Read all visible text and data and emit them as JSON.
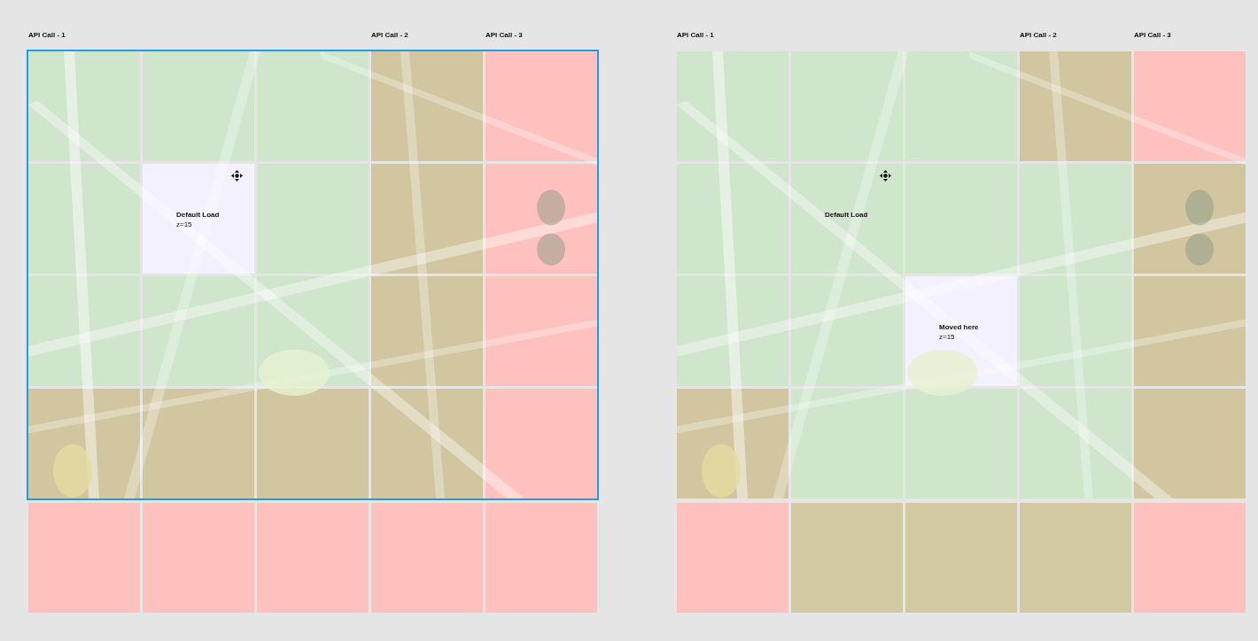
{
  "panels": [
    {
      "selected": true,
      "columns": [
        {
          "header": "API Call - 1"
        },
        {},
        {},
        {
          "header": "API Call - 2"
        },
        {
          "header": "API Call - 3"
        }
      ],
      "rows": [
        {
          "tiles": [
            {
              "color": "#cfe5cc"
            },
            {
              "color": "#cfe5cc"
            },
            {
              "color": "#cfe5cc"
            },
            {
              "color": "#d1c6a0"
            },
            {
              "color": "#ffc1bd"
            }
          ]
        },
        {
          "tiles": [
            {
              "color": "#cfe5cc"
            },
            {
              "color": "#f2f1fd",
              "title": "Default Load",
              "zoom": "z=15",
              "move_handle": true
            },
            {
              "color": "#cfe5cc"
            },
            {
              "color": "#d1c6a0"
            },
            {
              "color": "#ffc1bd"
            }
          ]
        },
        {
          "tiles": [
            {
              "color": "#cfe5cc"
            },
            {
              "color": "#cfe5cc"
            },
            {
              "color": "#cfe5cc"
            },
            {
              "color": "#d1c6a0"
            },
            {
              "color": "#ffc1bd"
            }
          ]
        },
        {
          "tiles": [
            {
              "color": "#d1c6a0"
            },
            {
              "color": "#d1c6a0"
            },
            {
              "color": "#d1c6a0"
            },
            {
              "color": "#d1c6a0"
            },
            {
              "color": "#ffc1bd"
            }
          ]
        }
      ],
      "bottom_row": [
        {
          "color": "#ffc1bd"
        },
        {
          "color": "#ffc1bd"
        },
        {
          "color": "#ffc1bd"
        },
        {
          "color": "#ffc1bd"
        },
        {
          "color": "#ffc1bd"
        }
      ]
    },
    {
      "selected": false,
      "columns": [
        {
          "header": "API Call - 1"
        },
        {},
        {},
        {
          "header": "API Call - 2"
        },
        {
          "header": "API Call - 3"
        }
      ],
      "rows": [
        {
          "tiles": [
            {
              "color": "#cfe5cc"
            },
            {
              "color": "#cfe5cc"
            },
            {
              "color": "#cfe5cc"
            },
            {
              "color": "#d1c6a0"
            },
            {
              "color": "#ffc1bd"
            }
          ]
        },
        {
          "tiles": [
            {
              "color": "#cfe5cc"
            },
            {
              "color": "#cfe5cc",
              "title": "Default Load",
              "move_handle": true
            },
            {
              "color": "#cfe5cc"
            },
            {
              "color": "#cfe5cc"
            },
            {
              "color": "#d1c6a0"
            }
          ]
        },
        {
          "tiles": [
            {
              "color": "#cfe5cc"
            },
            {
              "color": "#cfe5cc"
            },
            {
              "color": "#f2f1fd",
              "title": "Moved here",
              "zoom": "z=15"
            },
            {
              "color": "#cfe5cc"
            },
            {
              "color": "#d1c6a0"
            }
          ]
        },
        {
          "tiles": [
            {
              "color": "#d1c6a0"
            },
            {
              "color": "#cfe5cc"
            },
            {
              "color": "#cfe5cc"
            },
            {
              "color": "#cfe5cc"
            },
            {
              "color": "#d1c6a0"
            }
          ]
        }
      ],
      "bottom_row": [
        {
          "color": "#ffc1bd"
        },
        {
          "color": "#d2c8a2"
        },
        {
          "color": "#d2c8a2"
        },
        {
          "color": "#d2c8a2"
        },
        {
          "color": "#ffc1bd"
        }
      ]
    }
  ]
}
